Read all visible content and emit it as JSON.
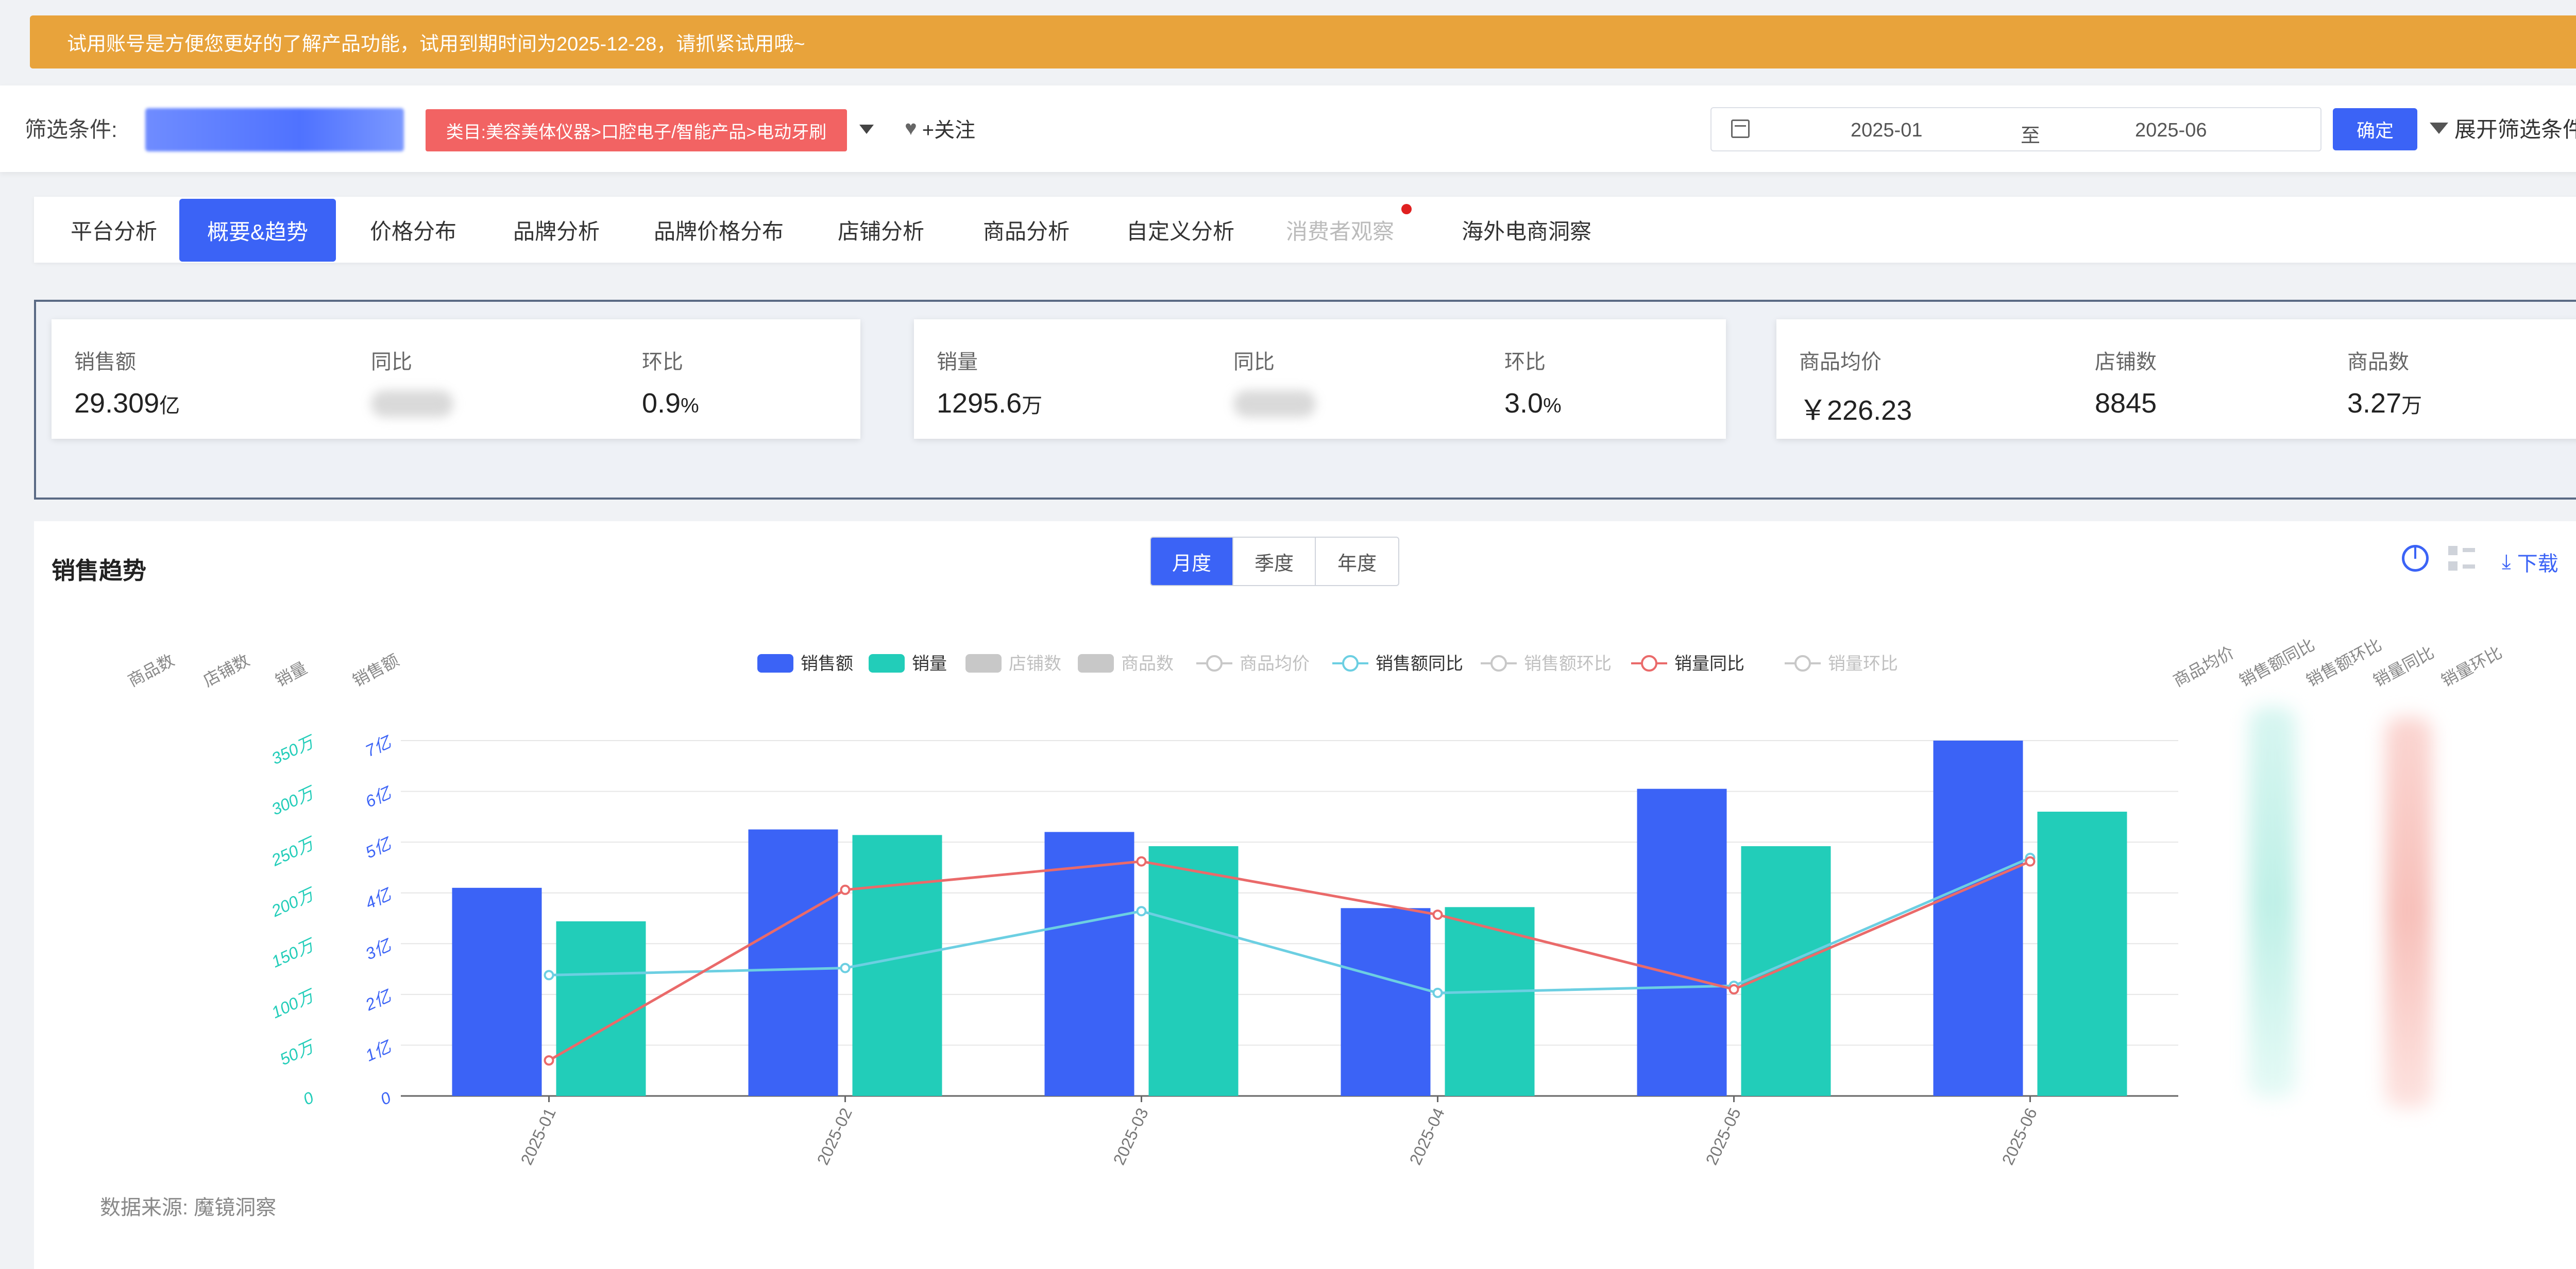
{
  "banner": {
    "text": "试用账号是方便您更好的了解产品功能，试用到期时间为2025-12-28，请抓紧试用哦~"
  },
  "filter": {
    "label": "筛选条件:",
    "category": "类目:美容美体仪器>口腔电子/智能产品>电动牙刷",
    "follow_label": "+关注",
    "date_start": "2025-01",
    "date_sep": "至",
    "date_end": "2025-06",
    "confirm_label": "确定",
    "expand_label": "展开筛选条件"
  },
  "tabs": [
    {
      "label": "平台分析",
      "state": "normal"
    },
    {
      "label": "概要&趋势",
      "state": "active"
    },
    {
      "label": "价格分布",
      "state": "normal"
    },
    {
      "label": "品牌分析",
      "state": "normal"
    },
    {
      "label": "品牌价格分布",
      "state": "normal"
    },
    {
      "label": "店铺分析",
      "state": "normal"
    },
    {
      "label": "商品分析",
      "state": "normal"
    },
    {
      "label": "自定义分析",
      "state": "normal"
    },
    {
      "label": "消费者观察",
      "state": "disabled"
    },
    {
      "label": "海外电商洞察",
      "state": "normal"
    }
  ],
  "kpi": {
    "sales_label": "销售额",
    "sales_value": "29.309",
    "sales_unit": "亿",
    "sales_yoy_label": "同比",
    "sales_mom_label": "环比",
    "sales_mom_value": "0.9",
    "sales_mom_unit": "%",
    "volume_label": "销量",
    "volume_value": "1295.6",
    "volume_unit": "万",
    "volume_yoy_label": "同比",
    "volume_mom_label": "环比",
    "volume_mom_value": "3.0",
    "volume_mom_unit": "%",
    "avg_price_label": "商品均价",
    "avg_price_value": "￥226.23",
    "shops_label": "店铺数",
    "shops_value": "8845",
    "items_label": "商品数",
    "items_value": "3.27",
    "items_unit": "万"
  },
  "panel": {
    "title": "销售趋势",
    "segments": [
      {
        "label": "月度",
        "on": true
      },
      {
        "label": "季度",
        "on": false
      },
      {
        "label": "年度",
        "on": false
      }
    ],
    "download_label": "下载",
    "source": "数据来源: 魔镜洞察"
  },
  "chart_data": {
    "type": "bar",
    "categories": [
      "2025-01",
      "2025-02",
      "2025-03",
      "2025-04",
      "2025-05",
      "2025-06"
    ],
    "legend": [
      {
        "name": "销售额",
        "color": "#3b63f6",
        "kind": "bar",
        "active": true
      },
      {
        "name": "销量",
        "color": "#22cdb9",
        "kind": "bar",
        "active": true
      },
      {
        "name": "店铺数",
        "color": "#c8c8c8",
        "kind": "bar",
        "active": false
      },
      {
        "name": "商品数",
        "color": "#c8c8c8",
        "kind": "bar",
        "active": false
      },
      {
        "name": "商品均价",
        "color": "#bbbbbb",
        "kind": "line",
        "active": false
      },
      {
        "name": "销售额同比",
        "color": "#6ccfe2",
        "kind": "line",
        "active": true
      },
      {
        "name": "销售额环比",
        "color": "#bbbbbb",
        "kind": "line",
        "active": false
      },
      {
        "name": "销量同比",
        "color": "#ea6a6a",
        "kind": "line",
        "active": true
      },
      {
        "name": "销量环比",
        "color": "#bbbbbb",
        "kind": "line",
        "active": false
      }
    ],
    "left_axis_names": [
      "商品数",
      "店铺数",
      "销量",
      "销售额"
    ],
    "right_axis_names": [
      "商品均价",
      "销售额同比",
      "销售额环比",
      "销量同比",
      "销量环比"
    ],
    "sales_axis": {
      "ticks": [
        "0",
        "1亿",
        "2亿",
        "3亿",
        "4亿",
        "5亿",
        "6亿",
        "7亿"
      ],
      "max": 7,
      "color": "#3b63f6"
    },
    "volume_axis": {
      "ticks": [
        "0",
        "50万",
        "100万",
        "150万",
        "200万",
        "250万",
        "300万",
        "350万"
      ],
      "max": 350,
      "color": "#22cdb9"
    },
    "series": [
      {
        "name": "销售额",
        "unit": "亿",
        "values": [
          4.1,
          5.25,
          5.2,
          3.7,
          6.05,
          7.0
        ]
      },
      {
        "name": "销量",
        "unit": "万",
        "values": [
          172,
          257,
          246,
          186,
          246,
          280
        ]
      }
    ],
    "line_series": [
      {
        "name": "销售额同比",
        "values": [
          0.34,
          0.36,
          0.52,
          0.29,
          0.31,
          0.67
        ]
      },
      {
        "name": "销量同比",
        "values": [
          0.1,
          0.58,
          0.66,
          0.51,
          0.3,
          0.66
        ]
      }
    ]
  }
}
